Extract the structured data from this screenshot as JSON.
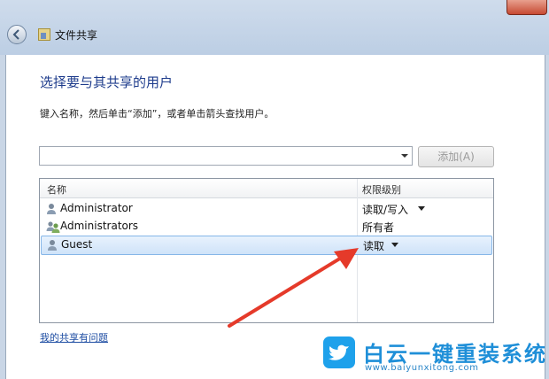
{
  "window": {
    "title": "文件共享"
  },
  "dialog": {
    "heading": "选择要与其共享的用户",
    "instruction": "键入名称，然后单击“添加”，或者单击箭头查找用户。",
    "name_input_value": "",
    "add_button_label": "添加(A)",
    "columns": [
      "名称",
      "权限级别"
    ],
    "rows": [
      {
        "name": "Administrator",
        "permission": "读取/写入",
        "has_dropdown": true,
        "icon": "user-icon",
        "selected": false
      },
      {
        "name": "Administrators",
        "permission": "所有者",
        "has_dropdown": false,
        "icon": "group-icon",
        "selected": false
      },
      {
        "name": "Guest",
        "permission": "读取",
        "has_dropdown": true,
        "icon": "user-icon",
        "selected": true
      }
    ],
    "help_link": "我的共享有问题"
  },
  "watermark": {
    "title": "白云一键重装系统",
    "url": "www.baiyunxitong.com"
  },
  "colors": {
    "heading": "#1e3c8c",
    "link": "#1f4ea3",
    "selection": "#cfe3f9",
    "annotation_arrow": "#e53a2a",
    "watermark": "#1ea1eb"
  }
}
